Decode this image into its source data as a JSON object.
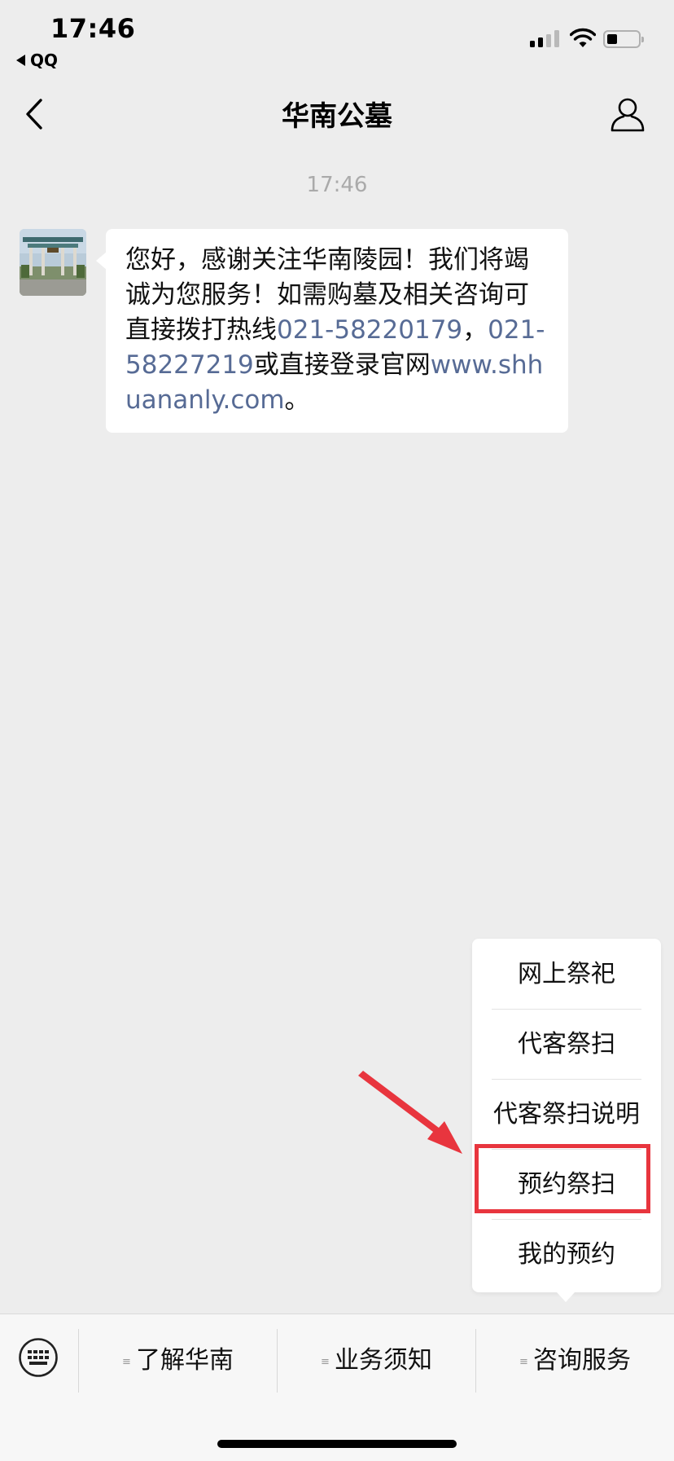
{
  "status_bar": {
    "time": "17:46",
    "back_app": "QQ",
    "signal_bars": 4,
    "signal_active": 2,
    "battery_level": 0.25
  },
  "nav": {
    "title": "华南公墓",
    "back_icon": "chevron-left-icon",
    "profile_icon": "person-icon"
  },
  "chat": {
    "timestamp": "17:46",
    "avatar_icon": "memorial-gate-photo",
    "message": {
      "text_1": "您好，感谢关注华南陵园！我们将竭诚为您服务！如需购墓及相关咨询可直接拨打热线",
      "phone_1": "021-58220179",
      "text_2": "，",
      "phone_2": "021-58227219",
      "text_3": "或直接登录官网",
      "website": "www.shhuananly.com",
      "text_4": "。"
    }
  },
  "popup_menu": {
    "items": [
      {
        "label": "网上祭祀"
      },
      {
        "label": "代客祭扫"
      },
      {
        "label": "代客祭扫说明"
      },
      {
        "label": "预约祭扫",
        "highlighted": true
      },
      {
        "label": "我的预约"
      }
    ]
  },
  "bottom_menu": {
    "keyboard_icon": "keyboard-icon",
    "items": [
      {
        "label": "了解华南"
      },
      {
        "label": "业务须知"
      },
      {
        "label": "咨询服务",
        "highlighted": true
      }
    ]
  },
  "colors": {
    "background": "#ededed",
    "link": "#576b95",
    "highlight": "#e8353e",
    "bubble": "#ffffff"
  }
}
